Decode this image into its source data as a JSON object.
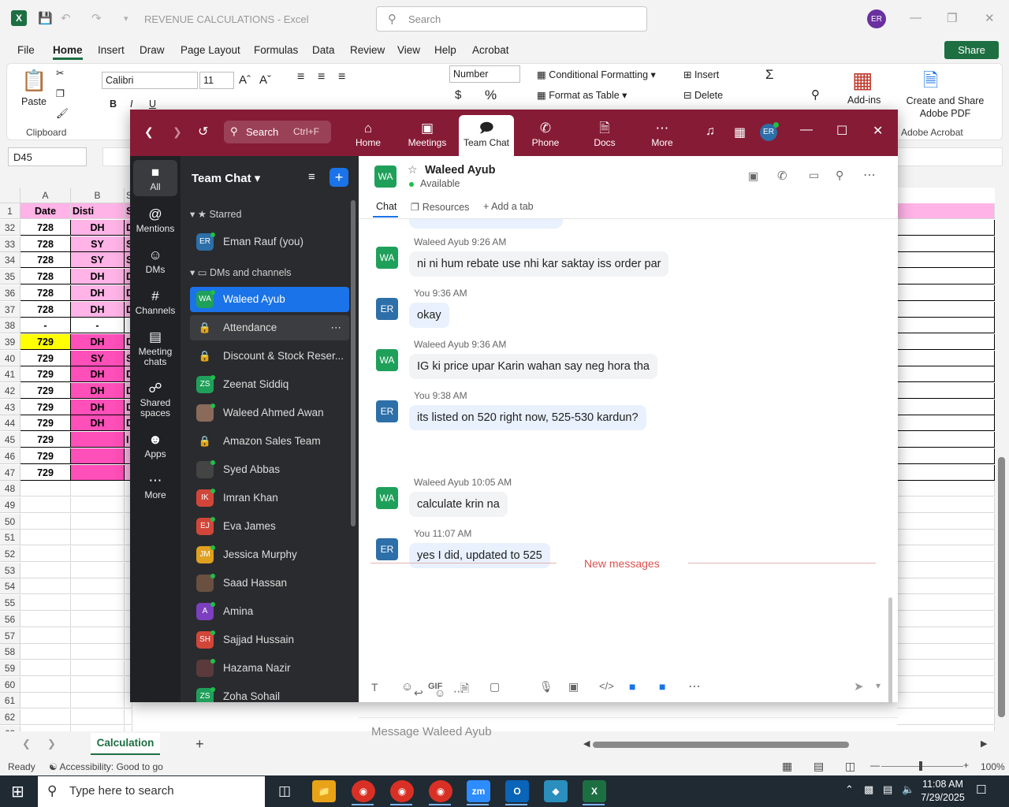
{
  "excel": {
    "title": "REVENUE CALCULATIONS  -  Excel",
    "search_placeholder": "Search",
    "user_initials": "ER",
    "tabs": [
      "File",
      "Home",
      "Insert",
      "Draw",
      "Page Layout",
      "Formulas",
      "Data",
      "Review",
      "View",
      "Help",
      "Acrobat"
    ],
    "share_label": "Share",
    "ribbon": {
      "paste": "Paste",
      "clipboard": "Clipboard",
      "font_name": "Calibri",
      "font_size": "11",
      "number_format": "Number",
      "conditional_formatting": "Conditional Formatting",
      "format_as_table": "Format as Table",
      "insert": "Insert",
      "delete": "Delete",
      "addins": "Add-ins",
      "create_share_pdf": "Create and Share Adobe PDF",
      "adobe_acrobat": "Adobe Acrobat"
    },
    "name_box": "D45",
    "columns": [
      "A",
      "B",
      "S"
    ],
    "header_row": {
      "num": "1",
      "a": "Date",
      "b": "Disti",
      "c": "S"
    },
    "rows": [
      {
        "n": "32",
        "a": "728",
        "b": "DH",
        "c": "D",
        "style": "p"
      },
      {
        "n": "33",
        "a": "728",
        "b": "SY",
        "c": "S",
        "style": "p"
      },
      {
        "n": "34",
        "a": "728",
        "b": "SY",
        "c": "S",
        "style": "p"
      },
      {
        "n": "35",
        "a": "728",
        "b": "DH",
        "c": "D",
        "style": "p"
      },
      {
        "n": "36",
        "a": "728",
        "b": "DH",
        "c": "D",
        "style": "p"
      },
      {
        "n": "37",
        "a": "728",
        "b": "DH",
        "c": "D",
        "style": "p"
      },
      {
        "n": "38",
        "a": "-",
        "b": "-",
        "c": "",
        "style": "w"
      },
      {
        "n": "39",
        "a": "729",
        "b": "DH",
        "c": "D",
        "style": "y"
      },
      {
        "n": "40",
        "a": "729",
        "b": "SY",
        "c": "S",
        "style": "m"
      },
      {
        "n": "41",
        "a": "729",
        "b": "DH",
        "c": "D",
        "style": "m"
      },
      {
        "n": "42",
        "a": "729",
        "b": "DH",
        "c": "D",
        "style": "m"
      },
      {
        "n": "43",
        "a": "729",
        "b": "DH",
        "c": "D",
        "style": "m"
      },
      {
        "n": "44",
        "a": "729",
        "b": "DH",
        "c": "D",
        "style": "m"
      },
      {
        "n": "45",
        "a": "729",
        "b": "",
        "c": "I",
        "style": "m"
      },
      {
        "n": "46",
        "a": "729",
        "b": "",
        "c": "",
        "style": "m"
      },
      {
        "n": "47",
        "a": "729",
        "b": "",
        "c": "",
        "style": "m"
      },
      {
        "n": "48",
        "a": "",
        "b": "",
        "c": "",
        "style": "e"
      },
      {
        "n": "49",
        "a": "",
        "b": "",
        "c": "",
        "style": "e"
      },
      {
        "n": "50",
        "a": "",
        "b": "",
        "c": "",
        "style": "e"
      },
      {
        "n": "51",
        "a": "",
        "b": "",
        "c": "",
        "style": "e"
      },
      {
        "n": "52",
        "a": "",
        "b": "",
        "c": "",
        "style": "e"
      },
      {
        "n": "53",
        "a": "",
        "b": "",
        "c": "",
        "style": "e"
      },
      {
        "n": "54",
        "a": "",
        "b": "",
        "c": "",
        "style": "e"
      },
      {
        "n": "55",
        "a": "",
        "b": "",
        "c": "",
        "style": "e"
      },
      {
        "n": "56",
        "a": "",
        "b": "",
        "c": "",
        "style": "e"
      },
      {
        "n": "57",
        "a": "",
        "b": "",
        "c": "",
        "style": "e"
      },
      {
        "n": "58",
        "a": "",
        "b": "",
        "c": "",
        "style": "e"
      },
      {
        "n": "59",
        "a": "",
        "b": "",
        "c": "",
        "style": "e"
      },
      {
        "n": "60",
        "a": "",
        "b": "",
        "c": "",
        "style": "e"
      },
      {
        "n": "61",
        "a": "",
        "b": "",
        "c": "",
        "style": "e"
      },
      {
        "n": "62",
        "a": "",
        "b": "",
        "c": "",
        "style": "e"
      },
      {
        "n": "63",
        "a": "",
        "b": "",
        "c": "",
        "style": "e"
      }
    ],
    "sheet_tab": "Calculation",
    "status_ready": "Ready",
    "accessibility": "Accessibility: Good to go",
    "zoom_level": "100%"
  },
  "zoom": {
    "search_label": "Search",
    "search_shortcut": "Ctrl+F",
    "nav": [
      "Home",
      "Meetings",
      "Team Chat",
      "Phone",
      "Docs",
      "More"
    ],
    "user_initials": "ER",
    "left_nav": [
      "All",
      "Mentions",
      "DMs",
      "Channels",
      "Meeting chats",
      "Shared spaces",
      "Apps",
      "More"
    ],
    "list_title": "Team Chat",
    "starred_label": "Starred",
    "dms_label": "DMs and channels",
    "starred_item": {
      "initials": "ER",
      "name": "Eman Rauf (you)"
    },
    "contacts": [
      {
        "initials": "WA",
        "name": "Waleed Ayub",
        "color": "#1fa05a",
        "selected": true
      },
      {
        "initials": "",
        "name": "Attendance",
        "color": "#5a5b5e",
        "lock": true,
        "hover": true
      },
      {
        "initials": "",
        "name": "Discount & Stock Reser...",
        "color": "#5a5b5e",
        "lock": true
      },
      {
        "initials": "ZS",
        "name": "Zeenat Siddiq",
        "color": "#1fa05a"
      },
      {
        "initials": "",
        "name": "Waleed Ahmed Awan",
        "color": "#8a6a5a"
      },
      {
        "initials": "",
        "name": "Amazon Sales Team",
        "color": "#5a5b5e",
        "lock": true
      },
      {
        "initials": "",
        "name": "Syed Abbas",
        "color": "#444"
      },
      {
        "initials": "IK",
        "name": "Imran Khan",
        "color": "#d2463a"
      },
      {
        "initials": "EJ",
        "name": "Eva James",
        "color": "#d2463a"
      },
      {
        "initials": "JM",
        "name": "Jessica Murphy",
        "color": "#e0a020"
      },
      {
        "initials": "",
        "name": "Saad Hassan",
        "color": "#6a5040"
      },
      {
        "initials": "A",
        "name": "Amina",
        "color": "#7b3fc0"
      },
      {
        "initials": "SH",
        "name": "Sajjad Hussain",
        "color": "#d2463a"
      },
      {
        "initials": "",
        "name": "Hazama Nazir",
        "color": "#5a3a3a"
      },
      {
        "initials": "ZS",
        "name": "Zoha Sohail",
        "color": "#1fa05a"
      }
    ],
    "chat_header": {
      "initials": "WA",
      "name": "Waleed Ayub",
      "status": "Available"
    },
    "chat_tabs": [
      "Chat",
      "Resources",
      "Add a tab"
    ],
    "messages": [
      {
        "from": "them",
        "initials": "WA",
        "meta": "Waleed Ayub 9:26 AM",
        "text": "ni ni hum rebate use nhi kar saktay iss order par"
      },
      {
        "from": "me",
        "initials": "ER",
        "meta": "You 9:36 AM",
        "text": "okay"
      },
      {
        "from": "them",
        "initials": "WA",
        "meta": "Waleed Ayub 9:36 AM",
        "text": "IG ki price upar Karin wahan say neg hora tha"
      },
      {
        "from": "me",
        "initials": "ER",
        "meta": "You 9:38 AM",
        "text": "its listed on 520 right now, 525-530 kardun?"
      },
      {
        "from": "them",
        "initials": "WA",
        "meta": "Waleed Ayub 10:05 AM",
        "text": "calculate krin na"
      },
      {
        "from": "me",
        "initials": "ER",
        "meta": "You 11:07 AM",
        "text": "yes I did, updated to 525"
      }
    ],
    "new_messages_label": "New messages",
    "compose_placeholder": "Message Waleed Ayub",
    "colors": {
      "titlebar": "#861b35",
      "accent": "#1a73e8",
      "avatar_green": "#1fa05a",
      "avatar_blue": "#2d6fa8",
      "new_messages": "#d9534f"
    }
  },
  "taskbar": {
    "search_placeholder": "Type here to search",
    "time": "11:08 AM",
    "date": "7/29/2025"
  }
}
